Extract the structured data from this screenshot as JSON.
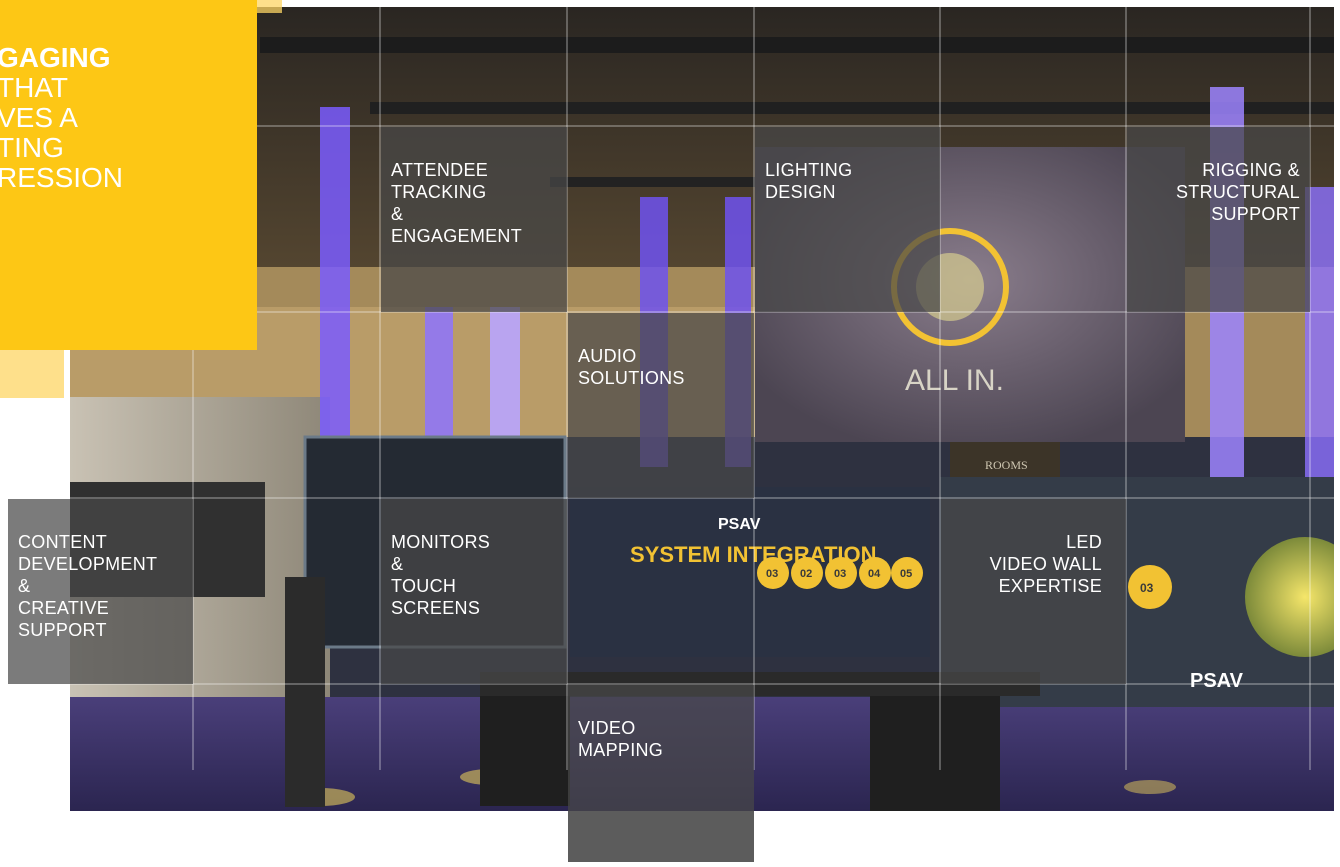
{
  "colors": {
    "accent": "#fdc715",
    "background": "#ffffff",
    "tile": "#484848",
    "led_purple": "#7a5cff",
    "truss_gold": "#f2c233"
  },
  "hero": {
    "lines": [
      "GAGING",
      "THAT",
      "VES A",
      "TING",
      "RESSION"
    ]
  },
  "photo": {
    "screen_logo": "ALL IN.",
    "screen_label": "ROOMS",
    "wall_logo": "PSAV",
    "wall_logo_right": "PSAV",
    "wall_title": "SYSTEM INTEGRATION",
    "hex_badges": [
      "03",
      "02",
      "03",
      "04",
      "05"
    ],
    "hex_right": "03"
  },
  "services": [
    {
      "key": "attendee",
      "label": "ATTENDEE\nTRACKING\n&\nENGAGEMENT"
    },
    {
      "key": "lighting",
      "label": "LIGHTING\nDESIGN"
    },
    {
      "key": "rigging",
      "label": "RIGGING &\nSTRUCTURAL\nSUPPORT"
    },
    {
      "key": "audio",
      "label": "AUDIO\nSOLUTIONS"
    },
    {
      "key": "content",
      "label": "CONTENT\nDEVELOPMENT\n&\nCREATIVE\nSUPPORT"
    },
    {
      "key": "monitors",
      "label": "MONITORS\n&\nTOUCH\nSCREENS"
    },
    {
      "key": "led",
      "label": "LED\nVIDEO WALL\nEXPERTISE"
    },
    {
      "key": "video_mapping",
      "label": "VIDEO\nMAPPING"
    }
  ],
  "extra_tile": ""
}
